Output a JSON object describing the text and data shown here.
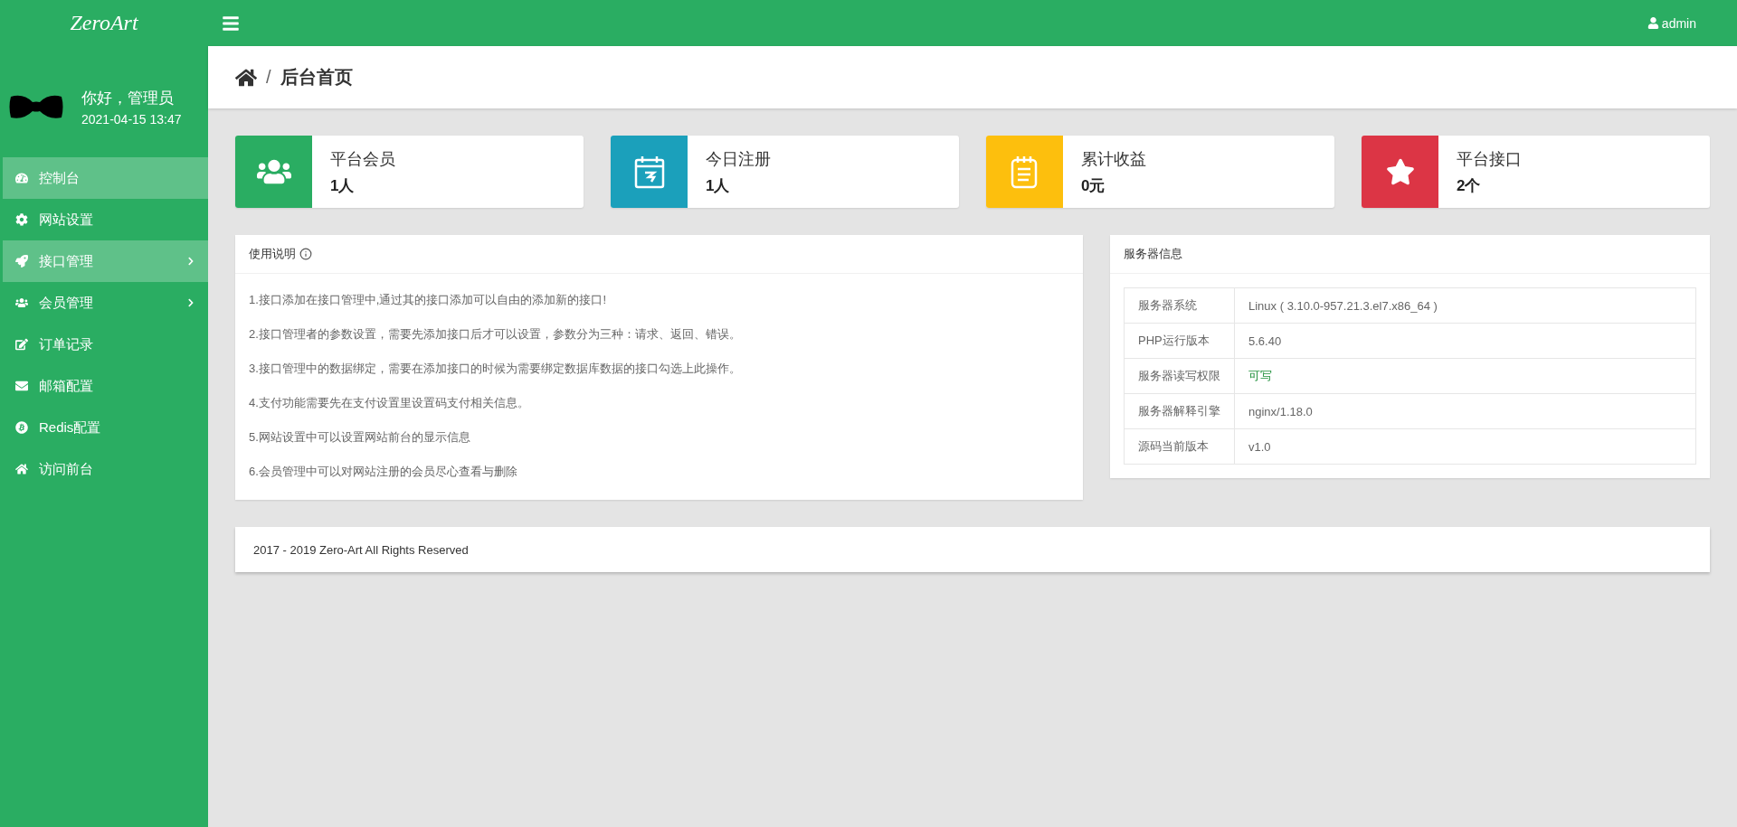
{
  "logo": "ZeroArt",
  "topbar": {
    "user": "admin"
  },
  "profile": {
    "greeting": "你好，管理员",
    "time": "2021-04-15 13:47"
  },
  "sidebar": {
    "items": [
      {
        "label": "控制台",
        "kind": "dashboard",
        "selected": true,
        "submenu": false
      },
      {
        "label": "网站设置",
        "kind": "gear",
        "selected": false,
        "submenu": false
      },
      {
        "label": "接口管理",
        "kind": "rocket",
        "selected": true,
        "submenu": true
      },
      {
        "label": "会员管理",
        "kind": "users",
        "selected": false,
        "submenu": true
      },
      {
        "label": "订单记录",
        "kind": "edit",
        "selected": false,
        "submenu": false
      },
      {
        "label": "邮箱配置",
        "kind": "mail",
        "selected": false,
        "submenu": false
      },
      {
        "label": "Redis配置",
        "kind": "bitcoin",
        "selected": false,
        "submenu": false
      },
      {
        "label": "访问前台",
        "kind": "home",
        "selected": false,
        "submenu": false
      }
    ]
  },
  "breadcrumb": {
    "separator": "/",
    "title": "后台首页"
  },
  "stats": [
    {
      "title": "平台会员",
      "value": "1人",
      "kind": "users",
      "color": "#2aad62"
    },
    {
      "title": "今日注册",
      "value": "1人",
      "kind": "calendar",
      "color": "#1ba0bb"
    },
    {
      "title": "累计收益",
      "value": "0元",
      "kind": "notepad",
      "color": "#fdbf0d"
    },
    {
      "title": "平台接口",
      "value": "2个",
      "kind": "star",
      "color": "#dc3545"
    }
  ],
  "usage": {
    "title": "使用说明",
    "lines": [
      "1.接口添加在接口管理中,通过其的接口添加可以自由的添加新的接口!",
      "2.接口管理者的参数设置，需要先添加接口后才可以设置，参数分为三种：请求、返回、错误。",
      "3.接口管理中的数据绑定，需要在添加接口的时候为需要绑定数据库数据的接口勾选上此操作。",
      "4.支付功能需要先在支付设置里设置码支付相关信息。",
      "5.网站设置中可以设置网站前台的显示信息",
      "6.会员管理中可以对网站注册的会员尽心查看与删除"
    ]
  },
  "server": {
    "title": "服务器信息",
    "rows": [
      {
        "label": "服务器系统",
        "value": "Linux ( 3.10.0-957.21.3.el7.x86_64 )",
        "kind": "text"
      },
      {
        "label": "PHP运行版本",
        "value": "5.6.40",
        "kind": "text"
      },
      {
        "label": "服务器读写权限",
        "value": "可写",
        "kind": "ok"
      },
      {
        "label": "服务器解释引擎",
        "value": "nginx/1.18.0",
        "kind": "text"
      },
      {
        "label": "源码当前版本",
        "value": "v1.0",
        "kind": "text"
      }
    ]
  },
  "footer": "2017 - 2019 Zero-Art All Rights Reserved"
}
